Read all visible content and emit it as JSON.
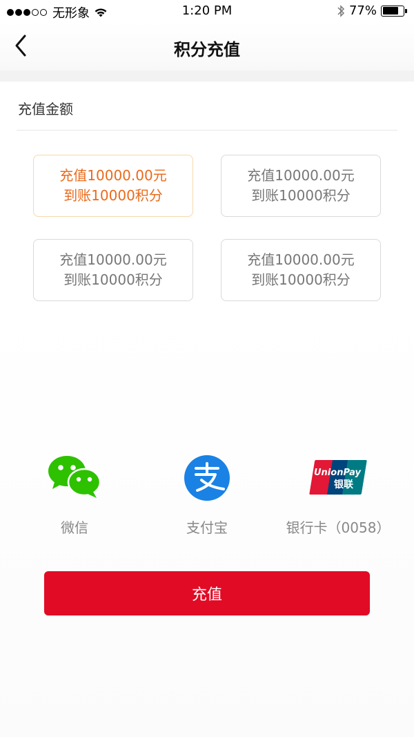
{
  "status_bar": {
    "carrier": "无形象",
    "time": "1:20 PM",
    "battery": "77%",
    "battery_level": 0.77
  },
  "nav": {
    "title": "积分充值"
  },
  "section": {
    "label": "充值金额"
  },
  "options": [
    {
      "line1": "充值10000.00元",
      "line2": "到账10000积分",
      "selected": true
    },
    {
      "line1": "充值10000.00元",
      "line2": "到账10000积分",
      "selected": false
    },
    {
      "line1": "充值10000.00元",
      "line2": "到账10000积分",
      "selected": false
    },
    {
      "line1": "充值10000.00元",
      "line2": "到账10000积分",
      "selected": false
    }
  ],
  "payment": {
    "wechat": {
      "label": "微信",
      "icon": "wechat-icon"
    },
    "alipay": {
      "label": "支付宝",
      "icon": "alipay-icon"
    },
    "unionpay": {
      "label": "银行卡（0058）",
      "icon": "unionpay-icon",
      "logo_text": "UnionPay",
      "logo_cn": "银联"
    }
  },
  "recharge_button": {
    "label": "充值"
  },
  "colors": {
    "accent_red": "#e10b26",
    "selected_orange": "#ea6a1a",
    "wechat_green": "#2dc100",
    "alipay_blue": "#1a82e4"
  }
}
